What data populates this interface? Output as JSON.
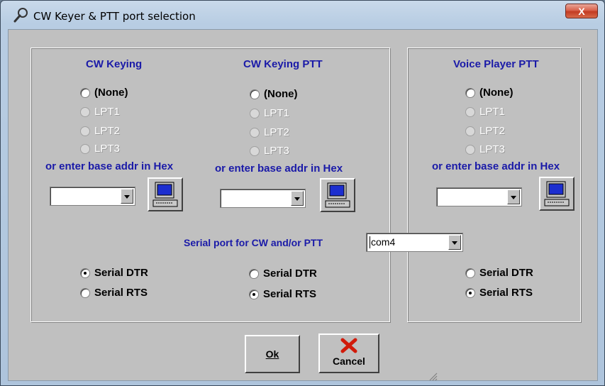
{
  "window": {
    "title": "CW Keyer & PTT port selection",
    "close": "X"
  },
  "cw_keying": {
    "header": "CW Keying",
    "options": [
      "(None)",
      "LPT1",
      "LPT2",
      "LPT3"
    ],
    "hex_label": "or enter base addr in Hex",
    "hex_value": ""
  },
  "cw_keying_ptt": {
    "header": "CW Keying PTT",
    "options": [
      "(None)",
      "LPT1",
      "LPT2",
      "LPT3"
    ],
    "hex_label": "or enter base addr in Hex",
    "hex_value": ""
  },
  "voice_player_ptt": {
    "header": "Voice Player PTT",
    "options": [
      "(None)",
      "LPT1",
      "LPT2",
      "LPT3"
    ],
    "hex_label": "or enter base addr in Hex",
    "hex_value": ""
  },
  "serial": {
    "label": "Serial port for CW and/or PTT",
    "selected": "com4",
    "dtr": "Serial DTR",
    "rts": "Serial RTS"
  },
  "buttons": {
    "ok": "Ok",
    "cancel": "Cancel"
  }
}
